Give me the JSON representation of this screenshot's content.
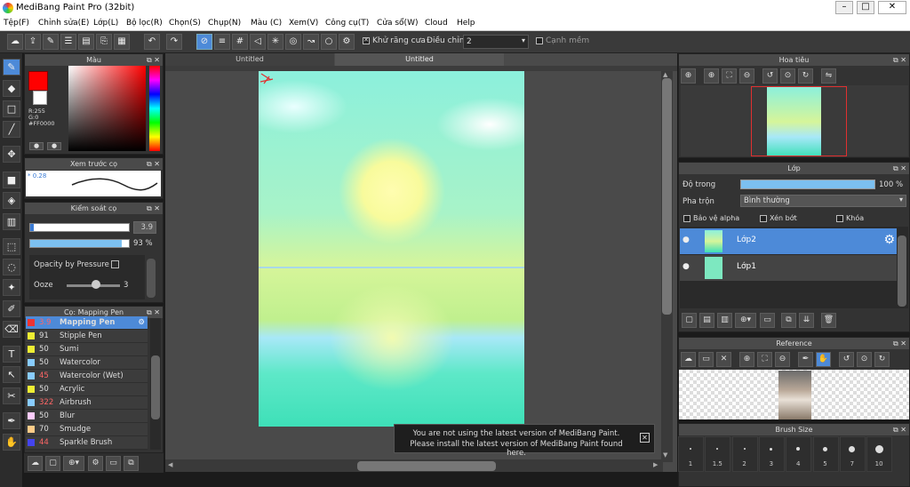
{
  "window": {
    "title": "MediBang Paint Pro (32bit)",
    "min": "–",
    "max": "□",
    "close": "✕"
  },
  "menu": [
    "Tệp(F)",
    "Chỉnh sửa(E)",
    "Lớp(L)",
    "Bộ lọc(R)",
    "Chọn(S)",
    "Chụp(N)",
    "Màu (C)",
    "Xem(V)",
    "Công cụ(T)",
    "Cửa sổ(W)",
    "Cloud",
    "Help"
  ],
  "toolbar": {
    "antialias_label": "Khử răng cưa",
    "antialias_checked": true,
    "adjust_label": "Điều chỉnh",
    "adjust_value": "2",
    "edge_label": "Cạnh mềm",
    "edge_checked": false
  },
  "color_panel": {
    "title": "Màu",
    "r": "R:255",
    "g": "G:0",
    "hex": "#FF0000",
    "fg": "#ff0000",
    "bg": "#ffffff"
  },
  "brush_preview": {
    "title": "Xem trước cọ",
    "size": "0.28"
  },
  "brush_control": {
    "title": "Kiểm soát cọ",
    "size": "3.9",
    "opacity": "93",
    "opacity_unit": "%",
    "opacity_pressure_label": "Opacity by Pressure",
    "ooze_label": "Ooze",
    "ooze_value": "3"
  },
  "brush_list": {
    "title": "Cọ: Mapping Pen",
    "items": [
      {
        "size": "3.9",
        "name": "Mapping Pen",
        "color": "#e33",
        "selected": true
      },
      {
        "size": "91",
        "name": "Stipple Pen",
        "color": "#ee3"
      },
      {
        "size": "50",
        "name": "Sumi",
        "color": "#ee3"
      },
      {
        "size": "50",
        "name": "Watercolor",
        "color": "#8cf"
      },
      {
        "size": "45",
        "name": "Watercolor (Wet)",
        "color": "#8cf"
      },
      {
        "size": "50",
        "name": "Acrylic",
        "color": "#ee3"
      },
      {
        "size": "322",
        "name": "Airbrush",
        "color": "#8cf"
      },
      {
        "size": "50",
        "name": "Blur",
        "color": "#fcf"
      },
      {
        "size": "70",
        "name": "Smudge",
        "color": "#fc8"
      },
      {
        "size": "44",
        "name": "Sparkle Brush",
        "color": "#44e"
      }
    ]
  },
  "documents": {
    "tabs": [
      "Untitled",
      "Untitled"
    ]
  },
  "notice": {
    "line1": "You are not using the latest version of MediBang Paint.",
    "line2": "Please install the latest version of MediBang Paint found here."
  },
  "navigator": {
    "title": "Hoa tiêu"
  },
  "layers": {
    "title": "Lớp",
    "opacity_label": "Độ trong",
    "opacity_value": "100",
    "opacity_unit": "%",
    "blend_label": "Pha trộn",
    "blend_value": "Bình thường",
    "protect_alpha": "Bảo vệ alpha",
    "clipping": "Xén bớt",
    "lock": "Khóa",
    "items": [
      {
        "name": "Lớp2",
        "selected": true
      },
      {
        "name": "Lớp1",
        "selected": false
      }
    ]
  },
  "reference": {
    "title": "Reference"
  },
  "brush_size": {
    "title": "Brush Size",
    "sizes": [
      "1",
      "1.5",
      "2",
      "3",
      "4",
      "5",
      "7",
      "10"
    ]
  }
}
